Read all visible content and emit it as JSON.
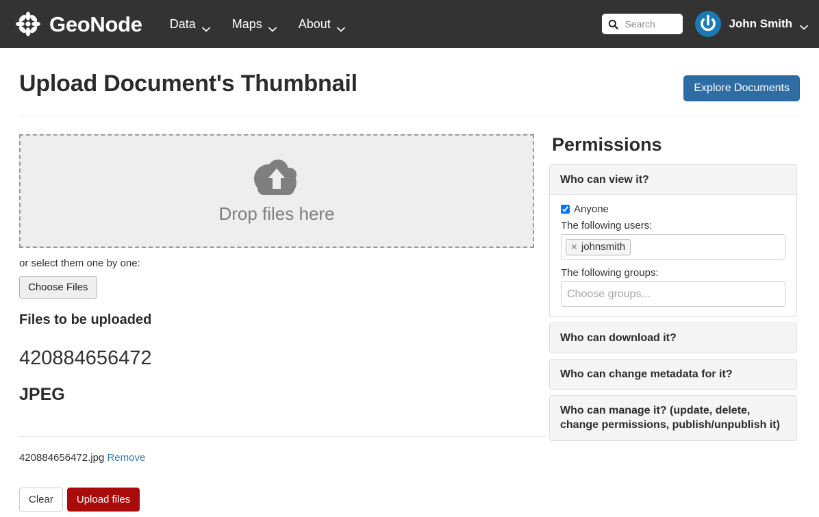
{
  "navbar": {
    "brand": "GeoNode",
    "logo_icon": "geonode-flower-logo",
    "links": [
      {
        "label": "Data",
        "icon": "chevron-down-icon"
      },
      {
        "label": "Maps",
        "icon": "chevron-down-icon"
      },
      {
        "label": "About",
        "icon": "chevron-down-icon"
      }
    ],
    "search": {
      "placeholder": "Search",
      "value": "",
      "icon": "search-icon"
    },
    "user": {
      "name": "John Smith",
      "avatar_icon": "user-avatar-power-icon",
      "caret_icon": "chevron-down-icon"
    },
    "background_color": "#333333"
  },
  "header": {
    "title": "Upload Document's Thumbnail",
    "explore_button": "Explore Documents",
    "explore_button_color": "#2e6da4"
  },
  "upload": {
    "dropzone": {
      "label": "Drop files here",
      "icon": "cloud-upload-icon"
    },
    "hint": "or select them one by one:",
    "choose_files_button": "Choose Files",
    "files_heading": "Files to be uploaded",
    "preview": {
      "name": "420884656472",
      "type": "JPEG"
    },
    "file_row": {
      "filename": "420884656472.jpg",
      "remove_label": "Remove"
    },
    "clear_button": "Clear",
    "upload_button": "Upload files",
    "upload_button_color": "#a90a0a"
  },
  "permissions": {
    "title": "Permissions",
    "panels": [
      {
        "title": "Who can view it?",
        "expanded": true,
        "anyone_label": "Anyone",
        "anyone_checked": true,
        "users_label": "The following users:",
        "users_tokens": [
          "johnsmith"
        ],
        "groups_label": "The following groups:",
        "groups_placeholder": "Choose groups..."
      },
      {
        "title": "Who can download it?",
        "expanded": false
      },
      {
        "title": "Who can change metadata for it?",
        "expanded": false
      },
      {
        "title": "Who can manage it? (update, delete, change permissions, publish/unpublish it)",
        "expanded": false
      }
    ]
  }
}
